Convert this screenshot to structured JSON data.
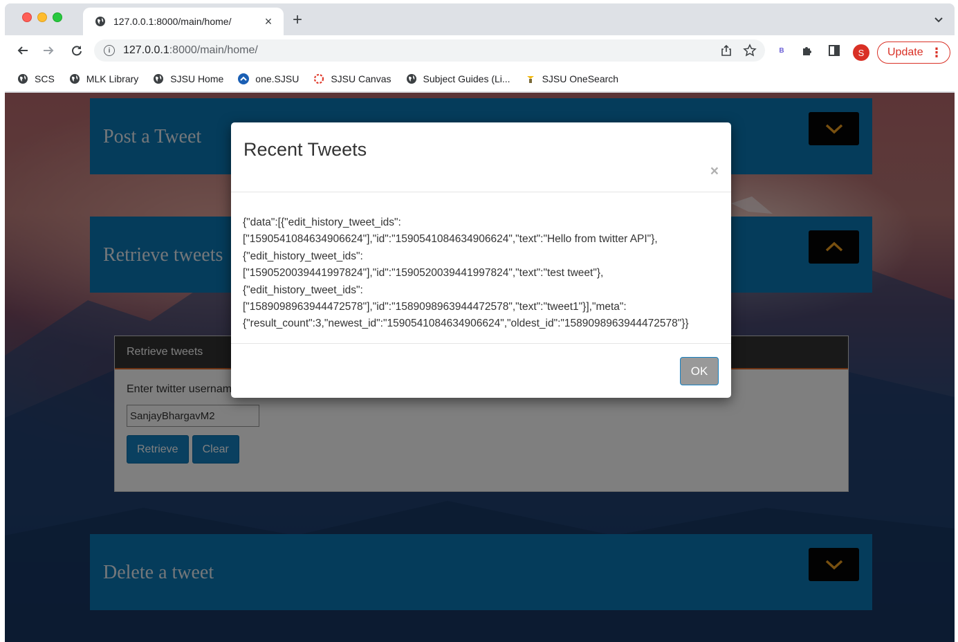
{
  "browser": {
    "tab_title": "127.0.0.1:8000/main/home/",
    "tab_close": "×",
    "new_tab": "+",
    "url_host": "127.0.0.1",
    "url_rest": ":8000/main/home/",
    "profile_initial": "S",
    "update_label": "Update",
    "extension_label": "B",
    "bookmarks": [
      {
        "label": "SCS",
        "icon": "globe-icon"
      },
      {
        "label": "MLK Library",
        "icon": "globe-icon"
      },
      {
        "label": "SJSU Home",
        "icon": "globe-icon"
      },
      {
        "label": "one.SJSU",
        "icon": "onesjsu-icon"
      },
      {
        "label": "SJSU Canvas",
        "icon": "canvas-icon"
      },
      {
        "label": "Subject Guides (Li...",
        "icon": "globe-icon"
      },
      {
        "label": "SJSU OneSearch",
        "icon": "onesearch-icon"
      }
    ]
  },
  "page": {
    "post_title": "Post a Tweet",
    "retrieve_title": "Retrieve tweets",
    "delete_title": "Delete a tweet",
    "card": {
      "header": "Retrieve tweets",
      "label": "Enter twitter username",
      "input_value": "SanjayBhargavM2",
      "retrieve_label": "Retrieve",
      "clear_label": "Clear"
    }
  },
  "modal": {
    "title": "Recent Tweets",
    "close": "×",
    "body_lines": [
      "{\"data\":[{\"edit_history_tweet_ids\":",
      "[\"1590541084634906624\"],\"id\":\"1590541084634906624\",\"text\":\"Hello from twitter API\"},",
      "{\"edit_history_tweet_ids\":",
      "[\"1590520039441997824\"],\"id\":\"1590520039441997824\",\"text\":\"test tweet\"},",
      "{\"edit_history_tweet_ids\":",
      "[\"1589098963944472578\"],\"id\":\"1589098963944472578\",\"text\":\"tweet1\"}],\"meta\":",
      "{\"result_count\":3,\"newest_id\":\"1590541084634906624\",\"oldest_id\":\"1589098963944472578\"}}"
    ],
    "ok_label": "OK"
  },
  "colors": {
    "panel_bar": "#0b78b6",
    "chevron": "#f0a020",
    "update_red": "#d93025"
  }
}
